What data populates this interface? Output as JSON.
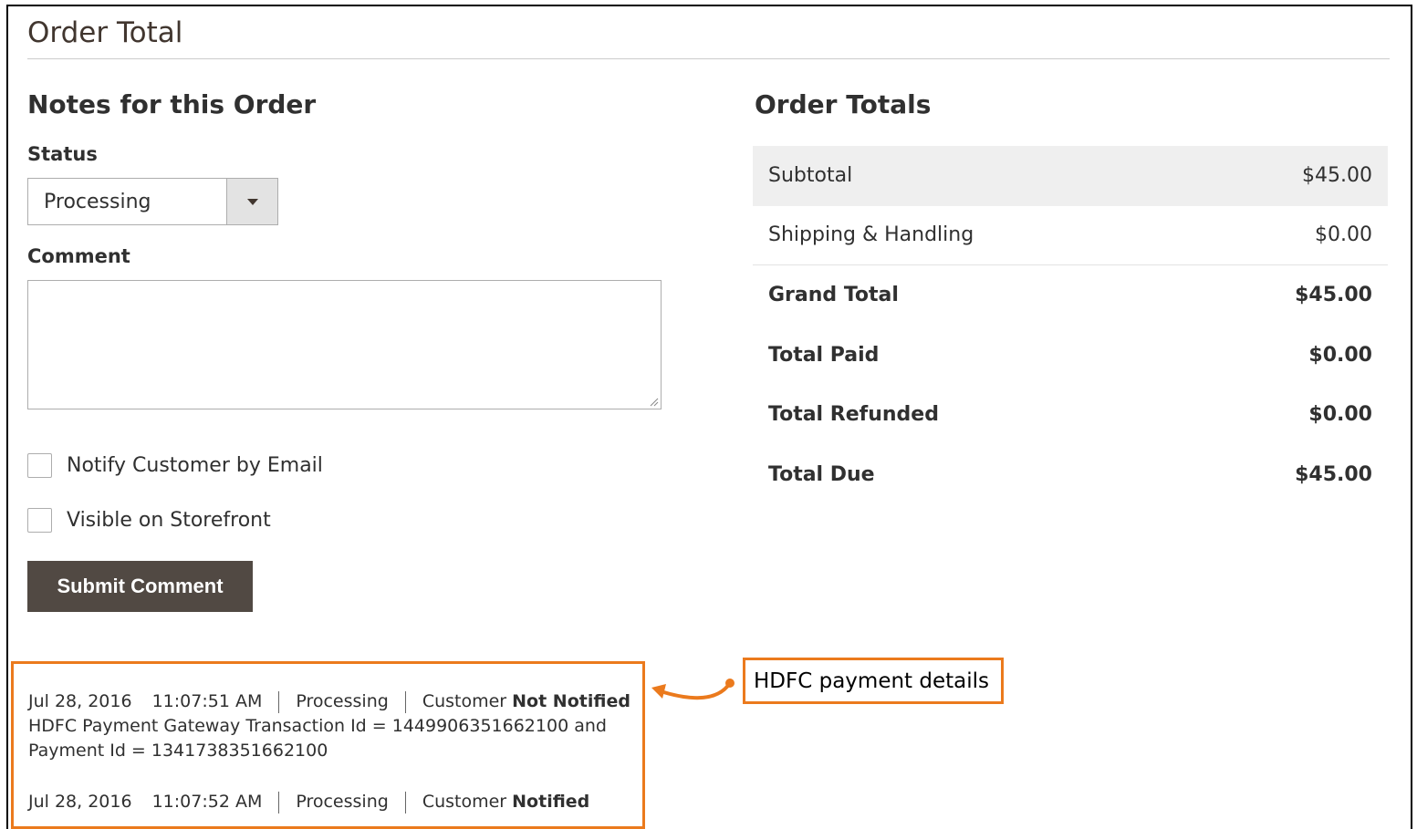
{
  "section": {
    "title": "Order Total"
  },
  "notes": {
    "title": "Notes for this Order",
    "status_label": "Status",
    "status_value": "Processing",
    "comment_label": "Comment",
    "comment_value": "",
    "notify_label": "Notify Customer by Email",
    "visible_label": "Visible on Storefront",
    "submit_label": "Submit Comment"
  },
  "totals": {
    "title": "Order Totals",
    "rows": [
      {
        "label": "Subtotal",
        "value": "$45.00"
      },
      {
        "label": "Shipping & Handling",
        "value": "$0.00"
      },
      {
        "label": "Grand Total",
        "value": "$45.00"
      },
      {
        "label": "Total Paid",
        "value": "$0.00"
      },
      {
        "label": "Total Refunded",
        "value": "$0.00"
      },
      {
        "label": "Total Due",
        "value": "$45.00"
      }
    ]
  },
  "history": [
    {
      "date": "Jul 28, 2016",
      "time": "11:07:51 AM",
      "status": "Processing",
      "customer_prefix": "Customer",
      "customer_state": "Not Notified",
      "comment_line1": "HDFC Payment Gateway Transaction Id = 1449906351662100 and",
      "comment_line2": "Payment Id = 1341738351662100"
    },
    {
      "date": "Jul 28, 2016",
      "time": "11:07:52 AM",
      "status": "Processing",
      "customer_prefix": "Customer",
      "customer_state": "Notified"
    }
  ],
  "annotation": {
    "text": "HDFC payment details",
    "color": "#eb7a1d"
  },
  "colors": {
    "button": "#514943",
    "accent": "#eb7a1d"
  },
  "icons": {
    "select": "chevron-down-icon",
    "resize": "resize-grip-icon",
    "annotation": "curved-arrow-icon"
  }
}
